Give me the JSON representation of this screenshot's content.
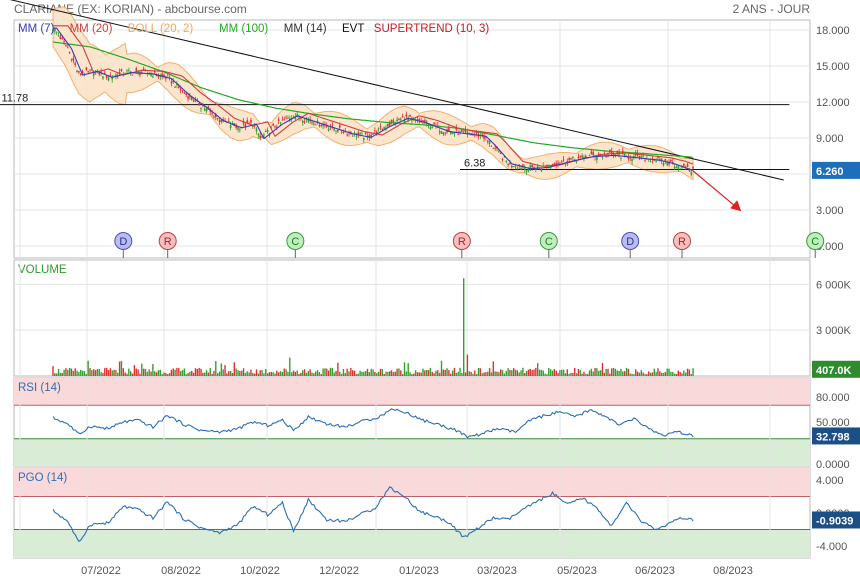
{
  "header": {
    "title": "CLARIANE (EX: KORIAN) - abcbourse.com",
    "period": "2 ANS - JOUR"
  },
  "legend": [
    {
      "label": "MM (7)",
      "color": "#3a3ab8"
    },
    {
      "label": "MM (20)",
      "color": "#d04040"
    },
    {
      "label": "BOLL (20, 2)",
      "color": "#f0a860"
    },
    {
      "label": "MM (100)",
      "color": "#22aa22"
    },
    {
      "label": "MM (14)",
      "color": "#333333"
    },
    {
      "label": "EVT",
      "color": "#111111"
    },
    {
      "label": "SUPERTREND (10, 3)",
      "color": "#c02020"
    }
  ],
  "colors": {
    "up": "#33a02c",
    "down": "#e03030",
    "rsi_line": "#2c6fb5",
    "panel_label": "#2e9a2e",
    "overbought_fill": "#f9d9d9",
    "oversold_fill": "#d8ecd6",
    "badge_price": "#1c6fb8",
    "badge_volume": "#2e8b2e",
    "badge_osc": "#1c4f86"
  },
  "chart_data": [
    {
      "panel": "price",
      "type": "line",
      "title": "CLARIANE (EX: KORIAN) - abcbourse.com",
      "y_ticks": [
        "18.000",
        "15.000",
        "12.000",
        "9.000",
        "6.000",
        "3.000",
        "0.000"
      ],
      "ylim": [
        0,
        18.5
      ],
      "x_ticks": [
        "07/2022",
        "08/2022",
        "10/2022",
        "12/2022",
        "01/2023",
        "03/2023",
        "05/2023",
        "06/2023",
        "08/2023"
      ],
      "price_path": [
        [
          0,
          18.2
        ],
        [
          8,
          16.5
        ],
        [
          14,
          14.3
        ],
        [
          22,
          14.6
        ],
        [
          30,
          14.1
        ],
        [
          40,
          14.5
        ],
        [
          52,
          14.4
        ],
        [
          62,
          14.0
        ],
        [
          72,
          12.6
        ],
        [
          82,
          11.5
        ],
        [
          90,
          10.5
        ],
        [
          100,
          9.9
        ],
        [
          108,
          10.2
        ],
        [
          112,
          9.0
        ],
        [
          122,
          10.2
        ],
        [
          130,
          10.9
        ],
        [
          140,
          10.4
        ],
        [
          150,
          9.9
        ],
        [
          160,
          9.4
        ],
        [
          170,
          9.1
        ],
        [
          180,
          10.0
        ],
        [
          190,
          10.7
        ],
        [
          200,
          10.3
        ],
        [
          212,
          9.6
        ],
        [
          222,
          9.4
        ],
        [
          232,
          9.2
        ],
        [
          236,
          8.6
        ],
        [
          246,
          6.9
        ],
        [
          256,
          6.5
        ],
        [
          266,
          6.6
        ],
        [
          278,
          7.1
        ],
        [
          290,
          7.5
        ],
        [
          302,
          7.6
        ],
        [
          314,
          7.4
        ],
        [
          326,
          7.2
        ],
        [
          334,
          6.9
        ],
        [
          342,
          6.45
        ],
        [
          346,
          6.26
        ]
      ],
      "ma100_path": [
        [
          0,
          17.0
        ],
        [
          20,
          16.6
        ],
        [
          40,
          15.6
        ],
        [
          60,
          14.5
        ],
        [
          80,
          13.2
        ],
        [
          100,
          12.2
        ],
        [
          120,
          11.5
        ],
        [
          140,
          11.0
        ],
        [
          160,
          10.6
        ],
        [
          180,
          10.3
        ],
        [
          200,
          10.1
        ],
        [
          220,
          9.8
        ],
        [
          240,
          9.2
        ],
        [
          260,
          8.6
        ],
        [
          280,
          8.2
        ],
        [
          300,
          7.9
        ],
        [
          320,
          7.7
        ],
        [
          346,
          7.4
        ]
      ],
      "trendline": [
        [
          -25,
          20.6
        ],
        [
          395,
          5.5
        ]
      ],
      "forecast_arrow": [
        [
          346,
          6.26
        ],
        [
          372,
          2.9
        ]
      ],
      "levels": [
        {
          "label": "11.78",
          "value": 11.78,
          "x_from": -30,
          "x_to": 398
        },
        {
          "label": "6.38",
          "value": 6.38,
          "x_from": 220,
          "x_to": 398
        }
      ],
      "last_value": "6.260",
      "markers": [
        {
          "letter": "D",
          "x": 38,
          "kind": "dividend"
        },
        {
          "letter": "R",
          "x": 62,
          "kind": "report"
        },
        {
          "letter": "C",
          "x": 131,
          "kind": "other"
        },
        {
          "letter": "R",
          "x": 221,
          "kind": "report"
        },
        {
          "letter": "C",
          "x": 268,
          "kind": "other"
        },
        {
          "letter": "D",
          "x": 312,
          "kind": "dividend"
        },
        {
          "letter": "R",
          "x": 340,
          "kind": "report"
        },
        {
          "letter": "C",
          "x": 412,
          "kind": "other"
        }
      ]
    },
    {
      "panel": "volume",
      "type": "bar",
      "title": "VOLUME",
      "y_ticks": [
        "6 000K",
        "3 000K"
      ],
      "ylim": [
        0,
        7200
      ],
      "last_value": "407.0K",
      "spikes": [
        {
          "x": 222,
          "value": 6400
        },
        {
          "x": 224,
          "value": 1400
        },
        {
          "x": 128,
          "value": 1200
        },
        {
          "x": 98,
          "value": 900
        },
        {
          "x": 190,
          "value": 900
        },
        {
          "x": 210,
          "value": 1000
        }
      ]
    },
    {
      "panel": "rsi",
      "type": "line",
      "title": "RSI (14)",
      "y_ticks": [
        "80.000",
        "50.000",
        "0.0000"
      ],
      "ylim": [
        0,
        100
      ],
      "bands": [
        70,
        30
      ],
      "last_value": "32.798",
      "path": [
        [
          0,
          55
        ],
        [
          8,
          48
        ],
        [
          14,
          35
        ],
        [
          20,
          45
        ],
        [
          30,
          42
        ],
        [
          38,
          50
        ],
        [
          46,
          52
        ],
        [
          54,
          44
        ],
        [
          62,
          58
        ],
        [
          70,
          48
        ],
        [
          80,
          40
        ],
        [
          90,
          38
        ],
        [
          100,
          42
        ],
        [
          108,
          50
        ],
        [
          116,
          46
        ],
        [
          124,
          52
        ],
        [
          130,
          40
        ],
        [
          138,
          56
        ],
        [
          148,
          48
        ],
        [
          158,
          44
        ],
        [
          166,
          50
        ],
        [
          176,
          56
        ],
        [
          184,
          66
        ],
        [
          192,
          60
        ],
        [
          200,
          52
        ],
        [
          210,
          46
        ],
        [
          218,
          40
        ],
        [
          224,
          32
        ],
        [
          232,
          36
        ],
        [
          240,
          42
        ],
        [
          250,
          38
        ],
        [
          258,
          52
        ],
        [
          266,
          58
        ],
        [
          274,
          62
        ],
        [
          282,
          56
        ],
        [
          290,
          64
        ],
        [
          298,
          58
        ],
        [
          306,
          46
        ],
        [
          314,
          54
        ],
        [
          322,
          42
        ],
        [
          330,
          34
        ],
        [
          338,
          38
        ],
        [
          346,
          32.8
        ]
      ]
    },
    {
      "panel": "pgo",
      "type": "line",
      "title": "PGO (14)",
      "y_ticks": [
        "4.000",
        "0.0000",
        "-4.000"
      ],
      "ylim": [
        -5.2,
        5.2
      ],
      "bands": [
        2,
        -2
      ],
      "last_value": "-0.9039",
      "path": [
        [
          0,
          0.3
        ],
        [
          8,
          -1.0
        ],
        [
          14,
          -3.6
        ],
        [
          20,
          -1.4
        ],
        [
          30,
          -1.2
        ],
        [
          38,
          0.8
        ],
        [
          46,
          0.4
        ],
        [
          54,
          -0.6
        ],
        [
          62,
          1.4
        ],
        [
          70,
          -0.6
        ],
        [
          80,
          -1.8
        ],
        [
          90,
          -2.4
        ],
        [
          100,
          -1.4
        ],
        [
          108,
          0.8
        ],
        [
          116,
          -0.2
        ],
        [
          124,
          1.2
        ],
        [
          130,
          -2.2
        ],
        [
          138,
          1.6
        ],
        [
          148,
          -0.8
        ],
        [
          158,
          -1.0
        ],
        [
          166,
          -0.2
        ],
        [
          174,
          0.6
        ],
        [
          182,
          3.1
        ],
        [
          190,
          2.0
        ],
        [
          198,
          0.2
        ],
        [
          206,
          -0.4
        ],
        [
          214,
          -1.1
        ],
        [
          222,
          -3.0
        ],
        [
          230,
          -1.8
        ],
        [
          238,
          -0.6
        ],
        [
          246,
          -0.8
        ],
        [
          254,
          0.4
        ],
        [
          262,
          1.4
        ],
        [
          270,
          2.4
        ],
        [
          278,
          1.0
        ],
        [
          286,
          1.8
        ],
        [
          294,
          0.6
        ],
        [
          302,
          -1.6
        ],
        [
          310,
          1.2
        ],
        [
          318,
          -1.0
        ],
        [
          326,
          -2.0
        ],
        [
          334,
          -1.2
        ],
        [
          340,
          -0.6
        ],
        [
          346,
          -0.9
        ]
      ]
    }
  ]
}
